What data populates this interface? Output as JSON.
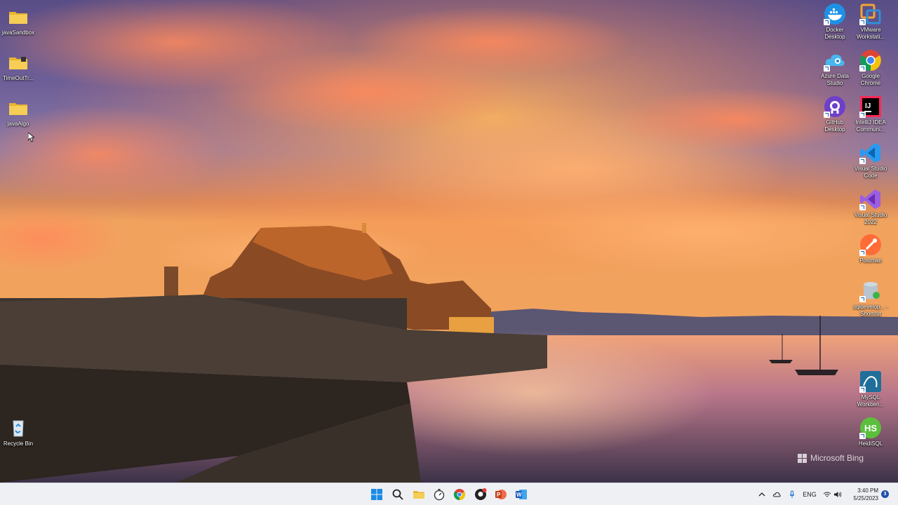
{
  "desktop": {
    "left_icons": [
      {
        "label": "javaSandbox",
        "icon": "folder-icon"
      },
      {
        "label": "TimeOutTr...",
        "icon": "folder-icon"
      },
      {
        "label": "javaAlgo",
        "icon": "folder-icon"
      },
      {
        "label": "Recycle Bin",
        "icon": "recycle-bin-icon"
      }
    ],
    "right_icons": [
      {
        "label": "Docker Desktop",
        "icon": "docker-icon"
      },
      {
        "label": "VMware Workstati...",
        "icon": "vmware-icon"
      },
      {
        "label": "Azure Data Studio",
        "icon": "azure-data-studio-icon"
      },
      {
        "label": "Google Chrome",
        "icon": "chrome-icon"
      },
      {
        "label": "GitHub Desktop",
        "icon": "github-icon"
      },
      {
        "label": "IntelliJ IDEA Communi...",
        "icon": "intellij-icon"
      },
      {
        "label": "Visual Studio Code",
        "icon": "vscode-icon"
      },
      {
        "label": "Visual Studio 2022",
        "icon": "visual-studio-icon"
      },
      {
        "label": "Postman",
        "icon": "postman-icon"
      },
      {
        "label": "sqldevelop... - Shortcut",
        "icon": "sqldeveloper-icon"
      },
      {
        "label": "MySQL Workben...",
        "icon": "mysql-workbench-icon"
      },
      {
        "label": "HeidiSQL",
        "icon": "heidisql-icon"
      }
    ],
    "wallpaper_credit": "Microsoft Bing"
  },
  "taskbar": {
    "apps": [
      {
        "name": "start-button",
        "icon": "windows-logo-icon"
      },
      {
        "name": "search-button",
        "icon": "search-icon"
      },
      {
        "name": "file-explorer",
        "icon": "folder-icon"
      },
      {
        "name": "app-timer",
        "icon": "stopwatch-icon"
      },
      {
        "name": "chrome",
        "icon": "chrome-icon"
      },
      {
        "name": "github-desktop",
        "icon": "github-icon"
      },
      {
        "name": "powerpoint",
        "icon": "powerpoint-icon"
      },
      {
        "name": "word",
        "icon": "word-icon"
      }
    ],
    "tray": {
      "language": "ENG",
      "time": "3:40 PM",
      "date": "5/25/2023",
      "notification_count": "3"
    }
  },
  "colors": {
    "taskbar_bg": "#eef0f4",
    "folder_yellow": "#f4c84a",
    "accent_blue": "#0078d4"
  }
}
